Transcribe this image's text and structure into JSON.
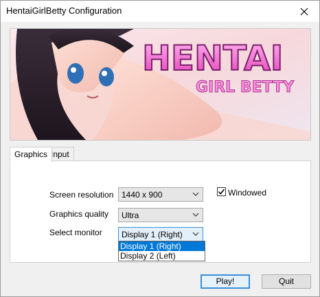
{
  "window": {
    "title": "HentaiGirlBetty Configuration"
  },
  "banner": {
    "logo_line1": "HENTAI",
    "logo_line2": "GIRL BETTY"
  },
  "tabs": [
    {
      "label": "Graphics",
      "active": true
    },
    {
      "label": "Input",
      "active": false
    }
  ],
  "graphics": {
    "resolution_label": "Screen resolution",
    "resolution_value": "1440 x 900",
    "quality_label": "Graphics quality",
    "quality_value": "Ultra",
    "monitor_label": "Select monitor",
    "monitor_value": "Display 1 (Right)",
    "monitor_options": [
      "Display 1 (Right)",
      "Display 2 (Left)"
    ],
    "windowed_label": "Windowed",
    "windowed_checked": true
  },
  "buttons": {
    "play_label": "Play!",
    "quit_label": "Quit"
  },
  "colors": {
    "selection": "#0078d7",
    "focus": "#3a8fd8",
    "logo_pink": "#ff6fd8"
  }
}
